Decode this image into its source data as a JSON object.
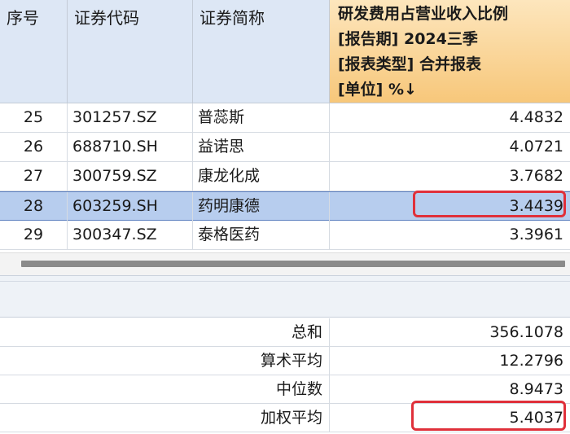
{
  "headers": {
    "seq": "序号",
    "code": "证券代码",
    "name": "证券简称",
    "metric_line1": "研发费用占营业收入比例",
    "metric_line2": "[报告期] 2024三季",
    "metric_line3": "[报表类型] 合并报表",
    "metric_line4": "[单位] %↓"
  },
  "rows": [
    {
      "seq": "25",
      "code": "301257.SZ",
      "name": "普蕊斯",
      "value": "4.4832"
    },
    {
      "seq": "26",
      "code": "688710.SH",
      "name": "益诺思",
      "value": "4.0721"
    },
    {
      "seq": "27",
      "code": "300759.SZ",
      "name": "康龙化成",
      "value": "3.7682"
    },
    {
      "seq": "28",
      "code": "603259.SH",
      "name": "药明康德",
      "value": "3.4439"
    },
    {
      "seq": "29",
      "code": "300347.SZ",
      "name": "泰格医药",
      "value": "3.3961"
    }
  ],
  "selected_row": "28",
  "summary": [
    {
      "label": "总和",
      "value": "356.1078"
    },
    {
      "label": "算术平均",
      "value": "12.2796"
    },
    {
      "label": "中位数",
      "value": "8.9473"
    },
    {
      "label": "加权平均",
      "value": "5.4037"
    }
  ],
  "colors": {
    "header_bg": "#dde7f5",
    "metric_header_bg": "#f7c77a",
    "selected_row": "#b7cdee",
    "highlight_box": "#e0303a"
  }
}
